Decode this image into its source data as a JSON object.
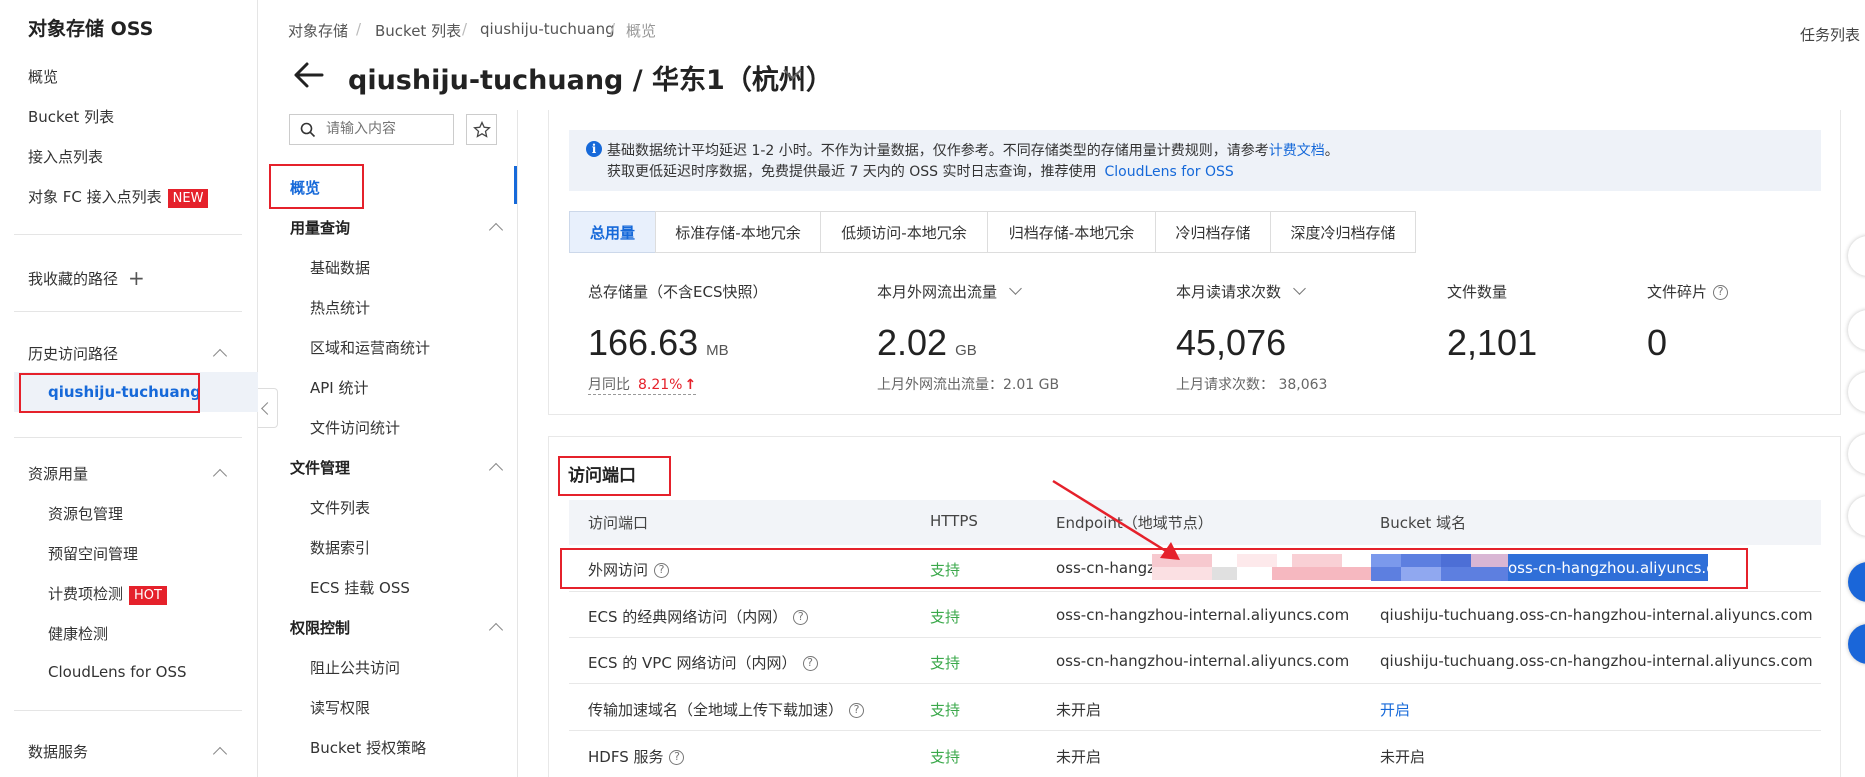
{
  "sidebar": {
    "title": "对象存储 OSS",
    "items": [
      "概览",
      "Bucket 列表",
      "接入点列表"
    ],
    "fc_item": "对象 FC 接入点列表",
    "fc_badge": "NEW",
    "favorites": "我收藏的路径",
    "history_header": "历史访问路径",
    "history_item": "qiushiju-tuchuang",
    "resource_header": "资源用量",
    "resource_items": [
      "资源包管理",
      "预留空间管理"
    ],
    "billing_item": "计费项检测",
    "billing_badge": "HOT",
    "resource_items2": [
      "健康检测",
      "CloudLens for OSS"
    ],
    "data_header": "数据服务"
  },
  "breadcrumb": [
    "对象存储",
    "Bucket 列表",
    "qiushiju-tuchuang",
    "概览"
  ],
  "header": {
    "title": "qiushiju-tuchuang / 华东1（杭州）",
    "task_list": "任务列表"
  },
  "nav2": {
    "search_placeholder": "请输入内容",
    "overview": "概览",
    "groups": [
      {
        "label": "用量查询",
        "items": [
          "基础数据",
          "热点统计",
          "区域和运营商统计",
          "API 统计",
          "文件访问统计"
        ]
      },
      {
        "label": "文件管理",
        "items": [
          "文件列表",
          "数据索引",
          "ECS 挂载 OSS"
        ]
      },
      {
        "label": "权限控制",
        "items": [
          "阻止公共访问",
          "读写权限",
          "Bucket 授权策略"
        ]
      }
    ]
  },
  "notice": {
    "line1": "基础数据统计平均延迟 1-2 小时。不作为计量数据，仅作参考。不同存储类型的存储用量计费规则，请参考",
    "link1": "计费文档",
    "line1_end": "。",
    "line2": "获取更低延迟时序数据，免费提供最近 7 天内的 OSS 实时日志查询，推荐使用",
    "link2": "CloudLens for OSS"
  },
  "tabs": [
    "总用量",
    "标准存储-本地冗余",
    "低频访问-本地冗余",
    "归档存储-本地冗余",
    "冷归档存储",
    "深度冷归档存储"
  ],
  "stats": [
    {
      "label": "总存储量（不含ECS快照）",
      "value": "166.63",
      "unit": "MB",
      "sub_label": "月同比",
      "sub_value": "8.21%"
    },
    {
      "label": "本月外网流出流量",
      "value": "2.02",
      "unit": "GB",
      "sub": "上月外网流出流量：2.01 GB"
    },
    {
      "label": "本月读请求次数",
      "value": "45,076",
      "unit": "",
      "sub": "上月请求次数：  38,063"
    },
    {
      "label": "文件数量",
      "value": "2,101",
      "unit": ""
    },
    {
      "label": "文件碎片",
      "value": "0",
      "unit": ""
    }
  ],
  "access": {
    "title": "访问端口",
    "headers": [
      "访问端口",
      "HTTPS",
      "Endpoint（地域节点）",
      "Bucket 域名"
    ],
    "rows": [
      {
        "port": "外网访问",
        "https": "支持",
        "endpoint": "oss-cn-hangzh",
        "domain": "oss-cn-hangzhou.aliyuncs.com"
      },
      {
        "port": "ECS 的经典网络访问（内网）",
        "https": "支持",
        "endpoint": "oss-cn-hangzhou-internal.aliyuncs.com",
        "domain": "qiushiju-tuchuang.oss-cn-hangzhou-internal.aliyuncs.com"
      },
      {
        "port": "ECS 的 VPC 网络访问（内网）",
        "https": "支持",
        "endpoint": "oss-cn-hangzhou-internal.aliyuncs.com",
        "domain": "qiushiju-tuchuang.oss-cn-hangzhou-internal.aliyuncs.com"
      },
      {
        "port": "传输加速域名（全地域上传下载加速）",
        "https": "支持",
        "endpoint": "未开启",
        "domain": "开启"
      },
      {
        "port": "HDFS 服务",
        "https": "支持",
        "endpoint": "未开启",
        "domain": "未开启"
      }
    ]
  },
  "colors": {
    "accent": "#1669d9",
    "annotation_red": "#e5212b",
    "success": "#3aa84a"
  }
}
